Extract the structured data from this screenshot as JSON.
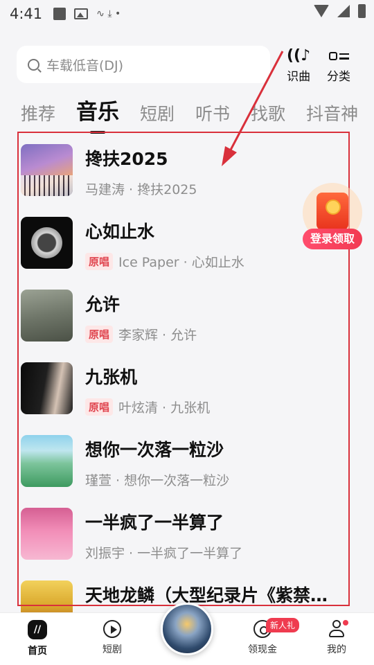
{
  "status_bar": {
    "time": "4:41",
    "extra_glyphs": "∿  ⤓  •"
  },
  "search": {
    "placeholder": "车载低音(DJ)"
  },
  "top_actions": {
    "recognize_label": "识曲",
    "recognize_icon": "music-recognize-icon",
    "category_label": "分类",
    "category_icon": "category-icon"
  },
  "tabs": [
    {
      "label": "推荐",
      "active": false
    },
    {
      "label": "音乐",
      "active": true
    },
    {
      "label": "短剧",
      "active": false
    },
    {
      "label": "听书",
      "active": false
    },
    {
      "label": "找歌",
      "active": false
    },
    {
      "label": "抖音神",
      "active": false
    }
  ],
  "songs": [
    {
      "title": "搀扶2025",
      "badge": "",
      "subtitle": "马建涛 · 搀扶2025"
    },
    {
      "title": "心如止水",
      "badge": "原唱",
      "subtitle": "Ice Paper · 心如止水"
    },
    {
      "title": "允许",
      "badge": "原唱",
      "subtitle": "李家辉 · 允许"
    },
    {
      "title": "九张机",
      "badge": "原唱",
      "subtitle": "叶炫清 · 九张机"
    },
    {
      "title": "想你一次落一粒沙",
      "badge": "",
      "subtitle": "瑾萱 · 想你一次落一粒沙"
    },
    {
      "title": "一半疯了一半算了",
      "badge": "",
      "subtitle": "刘振宇 · 一半疯了一半算了"
    },
    {
      "title": "天地龙鳞（大型纪录片《紫禁…",
      "badge": "",
      "subtitle": ""
    }
  ],
  "reward": {
    "label": "登录领取"
  },
  "bottom_nav": {
    "home": "首页",
    "short_drama": "短剧",
    "cash": "领现金",
    "cash_badge": "新人礼",
    "me": "我的"
  },
  "colors": {
    "annotation_red": "#d9303b",
    "badge_red": "#e0454f",
    "reward_red": "#f23a52"
  }
}
